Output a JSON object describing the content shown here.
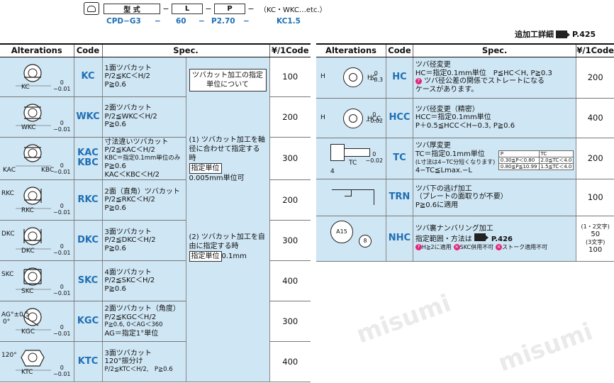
{
  "order": {
    "label_model": "型 式",
    "label_L": "L",
    "label_P": "P",
    "note": "（KC・WKC…etc.）",
    "example_model": "CPD−G3",
    "example_L": "60",
    "example_P": "P2.70",
    "example_code": "KC1.5",
    "dash": "−"
  },
  "detail_ref": {
    "text": "追加工詳細",
    "page": "P.425"
  },
  "headers": {
    "alterations": "Alterations",
    "code": "Code",
    "spec": "Spec.",
    "price": "¥/1Code"
  },
  "merged_note": {
    "title": "ツバカット加工の指定単位について",
    "item1": "(1) ツバカット加工を軸径に合わせて指定する時",
    "unit_label": "指定単位",
    "item1_value": "0.005mm単位可",
    "item2": "(2) ツバカット加工を自由に指定する時",
    "item2_value": "0.1mm"
  },
  "left_rows": [
    {
      "code": "KC",
      "spec": [
        "1面ツバカット",
        "P/2≦KC＜H/2",
        "P≧0.6"
      ],
      "price": "100",
      "dim": "KC",
      "tol": [
        "0",
        "−0.01"
      ]
    },
    {
      "code": "WKC",
      "spec": [
        "2面ツバカット",
        "P/2≦WKC＜H/2",
        "P≧0.6"
      ],
      "price": "200",
      "dim": "WKC",
      "tol": [
        "0",
        "−0.01"
      ]
    },
    {
      "code": "KAC\nKBC",
      "spec": [
        "寸法違いツバカット",
        "P/2≦KAC＜H/2",
        "KBC＝指定0.1mm単位のみ",
        "P≧0.6",
        "KAC＜KBC＜H/2"
      ],
      "price": "300",
      "dim": "KAC",
      "dim2": "KBC",
      "tol": [
        "0",
        "−0.01"
      ]
    },
    {
      "code": "RKC",
      "spec": [
        "2面（直角）ツバカット",
        "P/2≦RKC＜H/2",
        "P≧0.6"
      ],
      "price": "200",
      "dim": "RKC",
      "dim2": "RKC",
      "tol": [
        "0",
        "−0.01"
      ]
    },
    {
      "code": "DKC",
      "spec": [
        "3面ツバカット",
        "P/2≦DKC＜H/2",
        "P≧0.6"
      ],
      "price": "300",
      "dim": "DKC",
      "dim2": "DKC",
      "tol": [
        "0",
        "−0.01"
      ]
    },
    {
      "code": "SKC",
      "spec": [
        "4面ツバカット",
        "P/2≦SKC＜H/2",
        "P≧0.6"
      ],
      "price": "400",
      "dim": "SKC",
      "dim2": "SKC",
      "tol": [
        "0",
        "−0.01"
      ]
    },
    {
      "code": "KGC",
      "spec": [
        "2面ツバカット（角度）",
        "P/2≦KGC＜H/2",
        "P≧0.6, 0＜AG＜360",
        "AG＝指定1°単位"
      ],
      "price": "300",
      "dim": "KGC",
      "dim2": "AG°±0.5",
      "dim3": "0°",
      "tol": [
        "0",
        "−0.01"
      ]
    },
    {
      "code": "KTC",
      "spec": [
        "3面ツバカット",
        "120°振分け",
        "P/2≦KTC＜H/2,　P≧0.6"
      ],
      "price": "400",
      "dim": "KTC",
      "dim2": "120°",
      "tol": [
        "0",
        "−0.01"
      ]
    }
  ],
  "right_rows": [
    {
      "code": "HC",
      "spec": [
        "ツバ径変更",
        "HC＝指定0.1mm単位　P≦HC＜H, P≧0.3",
        "ツバ径公差の関係でストレートになる",
        "ケースがあります。"
      ],
      "price": "200",
      "dim": "H",
      "dim2": "HC",
      "tol": [
        "0",
        "−0.3"
      ]
    },
    {
      "code": "HCC",
      "spec": [
        "ツバ径変更（精密）",
        "HCC＝指定0.1mm単位",
        "P＋0.5≦HCC＜H−0.3, P≧0.6"
      ],
      "price": "400",
      "dim": "H",
      "dim2": "HCC",
      "tol": [
        "0",
        "−0.02"
      ]
    },
    {
      "code": "TC",
      "spec": [
        "ツバ厚変更",
        "TC＝指定0.1mm単位",
        "(L寸法は4−TC分短くなります)",
        "4−TC≦Lmax.−L"
      ],
      "price": "200",
      "dim": "TC",
      "dim2": "4",
      "tol": [
        "0",
        "−0.02"
      ],
      "mini": {
        "h1": "P",
        "h2": "TC",
        "r1c1": "0.30≦P＜0.80",
        "r1c2": "2.0≦TC＜4.0",
        "r2c1": "0.80≦P≦10.99",
        "r2c2": "1.5≦TC＜4.0"
      }
    },
    {
      "code": "TRN",
      "spec": [
        "ツバ下の逃げ加工",
        "（プレートの面取りが不要）",
        "P≧0.6に適用"
      ],
      "price": "100"
    },
    {
      "code": "NHC",
      "spec": [
        "ツバ裏ナンバリング加工",
        "指定範囲・方法は",
        "P.426",
        "H≧2に適用",
        "SKC併用不可",
        "ストーク適用不可"
      ],
      "price_a_label": "(1・2文字)",
      "price_a": "50",
      "price_b_label": "(3文字)",
      "price_b": "100",
      "mark1": "A15",
      "mark2": "8"
    }
  ],
  "watermark": "misumi"
}
